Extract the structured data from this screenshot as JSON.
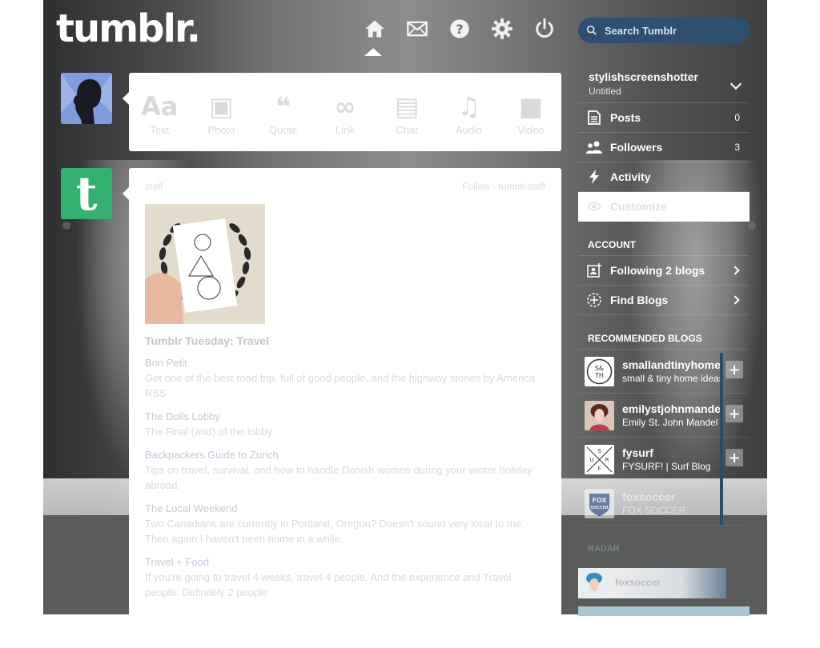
{
  "header": {
    "logo": "tumblr.",
    "search_placeholder": "Search Tumblr",
    "nav": [
      {
        "name": "home-icon"
      },
      {
        "name": "mail-icon"
      },
      {
        "name": "help-icon"
      },
      {
        "name": "settings-icon"
      },
      {
        "name": "power-icon"
      }
    ]
  },
  "post_types": [
    {
      "label": "Text",
      "glyph": "Aa"
    },
    {
      "label": "Photo",
      "glyph": "▣"
    },
    {
      "label": "Quote",
      "glyph": "❝"
    },
    {
      "label": "Link",
      "glyph": "∞"
    },
    {
      "label": "Chat",
      "glyph": "▤"
    },
    {
      "label": "Audio",
      "glyph": "♫"
    },
    {
      "label": "Video",
      "glyph": "■"
    }
  ],
  "post": {
    "author": "staff",
    "meta": "Follow · tumblr.staff",
    "title": "Tumblr Tuesday: Travel",
    "sections": [
      {
        "title": "Bon Petit",
        "text": "Get one of the best road trip, full of good people, and the highway stories by America. RSS"
      },
      {
        "title": "The Dolls Lobby",
        "text": "The Final (and) of the lobby"
      },
      {
        "title": "Backpackers Guide to Zurich",
        "text": "Tips on travel, survival, and how to handle Danish women during your winter holiday abroad."
      },
      {
        "title": "The Local Weekend",
        "text": "Two Canadians are currently in Portland, Oregon? Doesn't sound very local to me. Then again I haven't been home in a while."
      },
      {
        "title": "Travel + Food",
        "text": "If you're going to travel 4 weeks, travel 4 people. And the experience and Travel people. Definitely 2 people"
      }
    ]
  },
  "sidebar": {
    "blog_name": "stylishscreenshotter",
    "blog_subtitle": "Untitled",
    "rows": [
      {
        "label": "Posts",
        "count": "0",
        "icon": "posts-icon"
      },
      {
        "label": "Followers",
        "count": "3",
        "icon": "followers-icon"
      },
      {
        "label": "Activity",
        "count": "",
        "icon": "activity-icon"
      },
      {
        "label": "Customize",
        "count": "",
        "icon": "eye-icon"
      }
    ],
    "account_title": "ACCOUNT",
    "account_rows": [
      {
        "label": "Following 2 blogs",
        "icon": "following-icon"
      },
      {
        "label": "Find Blogs",
        "icon": "find-blogs-icon"
      }
    ],
    "recommended_title": "RECOMMENDED BLOGS",
    "recommended": [
      {
        "name": "smallandtinyhome",
        "desc": "small & tiny home ideas",
        "avatar": "S&TH"
      },
      {
        "name": "emilystjohnmande",
        "desc": "Emily St. John Mandel",
        "avatar": "face"
      },
      {
        "name": "fysurf",
        "desc": "FYSURF! | Surf Blog",
        "avatar": "SURF"
      },
      {
        "name": "foxsoccer",
        "desc": "FOX SOCCER",
        "avatar": "FOX SOCCER"
      }
    ],
    "radar_title": "RADAR",
    "radar_item": "foxsoccer"
  },
  "colors": {
    "search_bg": "#2e4f70",
    "staff_avatar": "#35b16f",
    "user_avatar": "#7f9ddc",
    "scroll_indicator": "#2e4a6a"
  }
}
